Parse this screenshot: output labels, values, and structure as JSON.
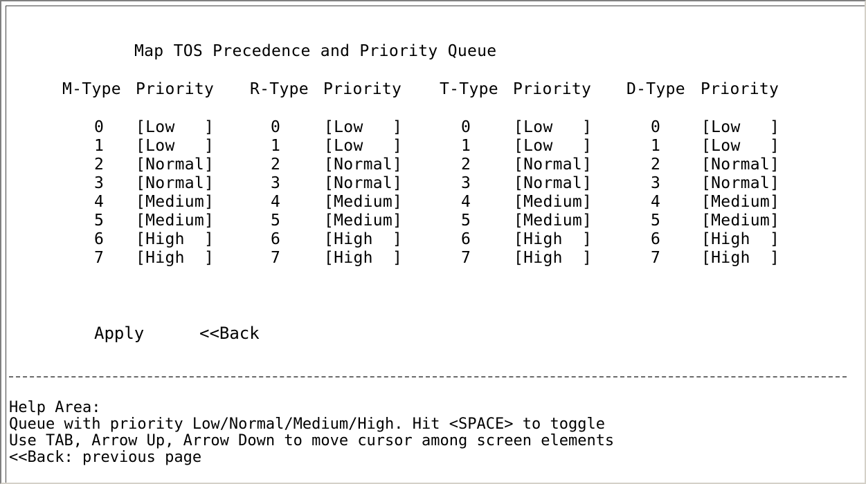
{
  "title": "Map TOS Precedence and Priority Queue",
  "columns": [
    {
      "type_label": "M-Type",
      "priority_label": "Priority",
      "rows": [
        {
          "index": "0",
          "priority": "[Low   ]"
        },
        {
          "index": "1",
          "priority": "[Low   ]"
        },
        {
          "index": "2",
          "priority": "[Normal]"
        },
        {
          "index": "3",
          "priority": "[Normal]"
        },
        {
          "index": "4",
          "priority": "[Medium]"
        },
        {
          "index": "5",
          "priority": "[Medium]"
        },
        {
          "index": "6",
          "priority": "[High  ]"
        },
        {
          "index": "7",
          "priority": "[High  ]"
        }
      ]
    },
    {
      "type_label": "R-Type",
      "priority_label": "Priority",
      "rows": [
        {
          "index": "0",
          "priority": "[Low   ]"
        },
        {
          "index": "1",
          "priority": "[Low   ]"
        },
        {
          "index": "2",
          "priority": "[Normal]"
        },
        {
          "index": "3",
          "priority": "[Normal]"
        },
        {
          "index": "4",
          "priority": "[Medium]"
        },
        {
          "index": "5",
          "priority": "[Medium]"
        },
        {
          "index": "6",
          "priority": "[High  ]"
        },
        {
          "index": "7",
          "priority": "[High  ]"
        }
      ]
    },
    {
      "type_label": "T-Type",
      "priority_label": "Priority",
      "rows": [
        {
          "index": "0",
          "priority": "[Low   ]"
        },
        {
          "index": "1",
          "priority": "[Low   ]"
        },
        {
          "index": "2",
          "priority": "[Normal]"
        },
        {
          "index": "3",
          "priority": "[Normal]"
        },
        {
          "index": "4",
          "priority": "[Medium]"
        },
        {
          "index": "5",
          "priority": "[Medium]"
        },
        {
          "index": "6",
          "priority": "[High  ]"
        },
        {
          "index": "7",
          "priority": "[High  ]"
        }
      ]
    },
    {
      "type_label": "D-Type",
      "priority_label": "Priority",
      "rows": [
        {
          "index": "0",
          "priority": "[Low   ]"
        },
        {
          "index": "1",
          "priority": "[Low   ]"
        },
        {
          "index": "2",
          "priority": "[Normal]"
        },
        {
          "index": "3",
          "priority": "[Normal]"
        },
        {
          "index": "4",
          "priority": "[Medium]"
        },
        {
          "index": "5",
          "priority": "[Medium]"
        },
        {
          "index": "6",
          "priority": "[High  ]"
        },
        {
          "index": "7",
          "priority": "[High  ]"
        }
      ]
    }
  ],
  "buttons": {
    "apply": "Apply",
    "back": "<<Back"
  },
  "help": {
    "heading": "Help Area:",
    "line1": "Queue with priority Low/Normal/Medium/High. Hit <SPACE> to toggle",
    "line2": "Use TAB, Arrow Up, Arrow Down to move cursor among screen elements",
    "line3": "<<Back: previous page"
  },
  "colors": {
    "background": "#ffffff",
    "text": "#000000",
    "divider": "#6a6a6a"
  }
}
